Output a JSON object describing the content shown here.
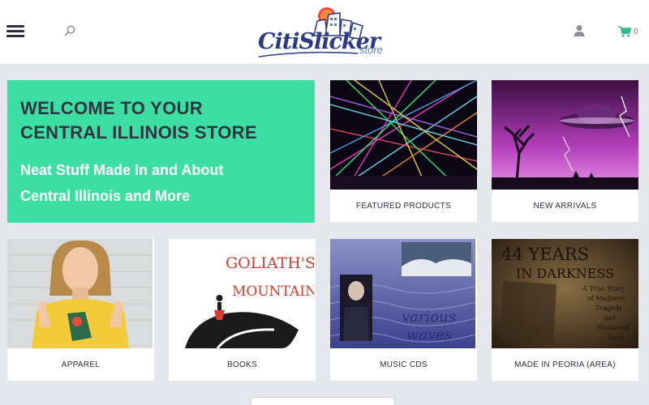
{
  "header": {
    "logo_text": "CitiSlicker",
    "logo_sub": "store",
    "cart_count": "0",
    "icons": [
      "menu-icon",
      "search-icon",
      "account-icon",
      "cart-icon"
    ],
    "accent_color": "#2fb98c"
  },
  "welcome": {
    "title_line1": "WELCOME TO YOUR",
    "title_line2": "CENTRAL ILLINOIS STORE",
    "sub_line1": "Neat Stuff Made In and About",
    "sub_line2": "Central Illinois and More",
    "bg_color": "#3ddea4"
  },
  "categories": [
    {
      "label": "FEATURED PRODUCTS"
    },
    {
      "label": "NEW ARRIVALS"
    },
    {
      "label": "APPAREL"
    },
    {
      "label": "BOOKS"
    },
    {
      "label": "MUSIC CDS"
    },
    {
      "label": "MADE IN PEORIA (AREA)"
    }
  ],
  "card_images": {
    "books_title_line1": "GOLIATH'S",
    "books_title_line2": "MOUNTAIN",
    "music_title_line1": "various",
    "music_title_line2": "waves",
    "peoria_title_line1": "44 YEARS",
    "peoria_title_line2": "IN DARKNESS",
    "peoria_sub_line1": "A True Story",
    "peoria_sub_line2": "of Madness,",
    "peoria_sub_line3": "Tragedy",
    "peoria_sub_line4": "and",
    "peoria_sub_line5": "Shattered",
    "peoria_sub_line6": "Love"
  }
}
